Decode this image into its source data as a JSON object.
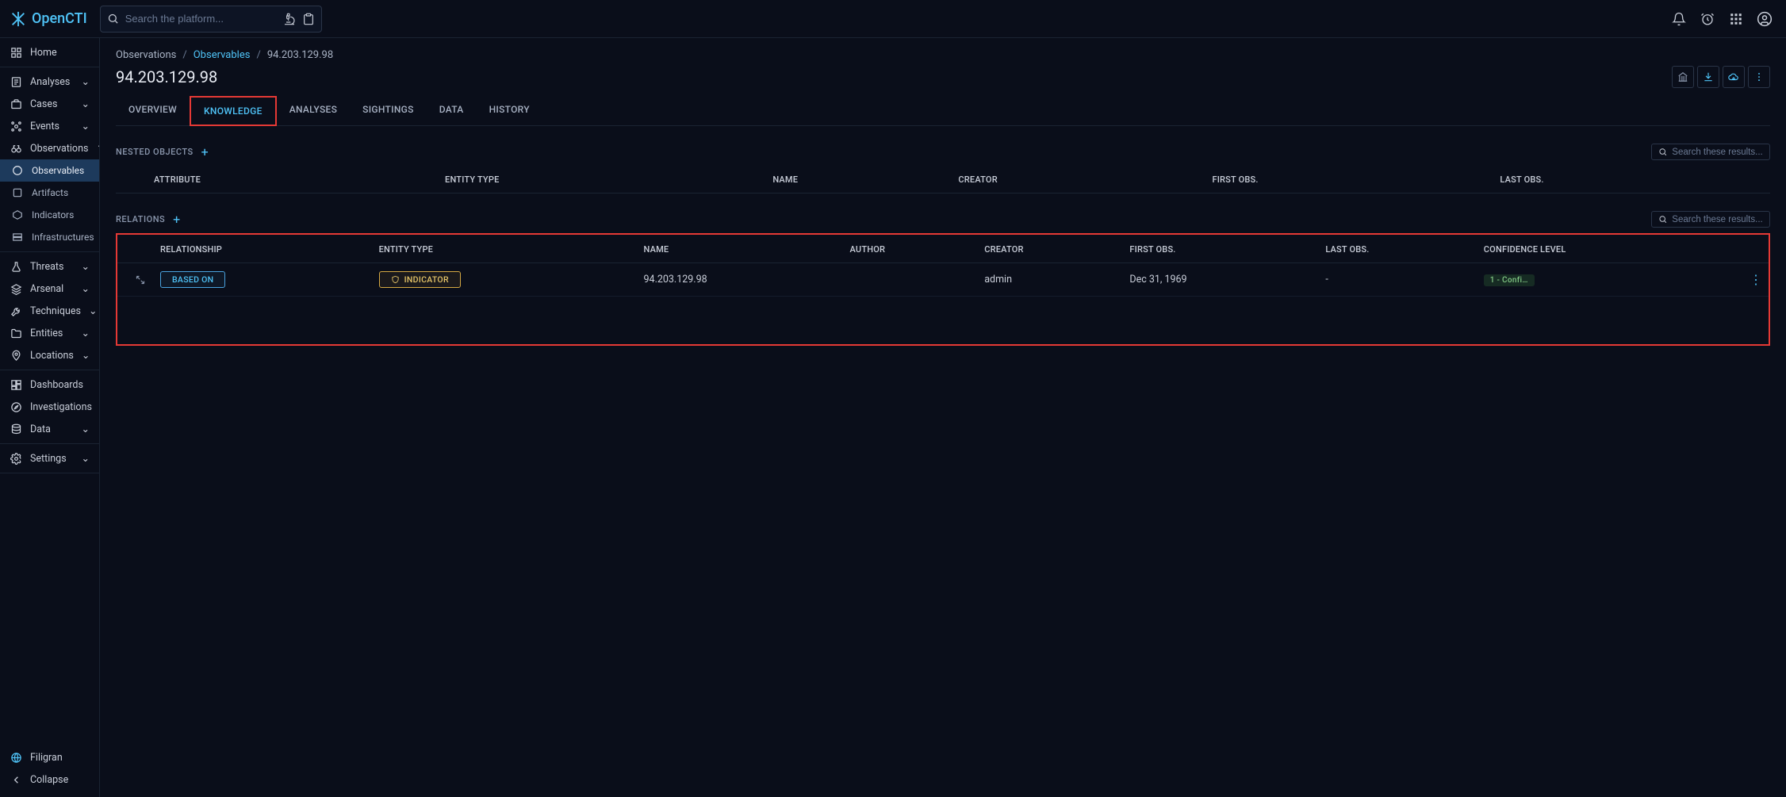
{
  "app": {
    "name": "OpenCTI"
  },
  "search": {
    "placeholder": "Search the platform..."
  },
  "sidebar": {
    "home": "Home",
    "analyses": "Analyses",
    "cases": "Cases",
    "events": "Events",
    "observations": "Observations",
    "obs_children": {
      "observables": "Observables",
      "artifacts": "Artifacts",
      "indicators": "Indicators",
      "infrastructures": "Infrastructures"
    },
    "threats": "Threats",
    "arsenal": "Arsenal",
    "techniques": "Techniques",
    "entities": "Entities",
    "locations": "Locations",
    "dashboards": "Dashboards",
    "investigations": "Investigations",
    "data": "Data",
    "settings": "Settings",
    "filigran": "Filigran",
    "collapse": "Collapse"
  },
  "breadcrumb": {
    "level1": "Observations",
    "level2": "Observables",
    "level3": "94.203.129.98"
  },
  "page": {
    "title": "94.203.129.98"
  },
  "tabs": {
    "overview": "OVERVIEW",
    "knowledge": "KNOWLEDGE",
    "analyses": "ANALYSES",
    "sightings": "SIGHTINGS",
    "data": "DATA",
    "history": "HISTORY"
  },
  "nested": {
    "title": "NESTED OBJECTS",
    "search_placeholder": "Search these results...",
    "headers": {
      "attribute": "ATTRIBUTE",
      "entity_type": "ENTITY TYPE",
      "name": "NAME",
      "creator": "CREATOR",
      "first_obs": "FIRST OBS.",
      "last_obs": "LAST OBS."
    }
  },
  "relations": {
    "title": "RELATIONS",
    "search_placeholder": "Search these results...",
    "headers": {
      "relationship": "RELATIONSHIP",
      "entity_type": "ENTITY TYPE",
      "name": "NAME",
      "author": "AUTHOR",
      "creator": "CREATOR",
      "first_obs": "FIRST OBS.",
      "last_obs": "LAST OBS.",
      "confidence": "CONFIDENCE LEVEL"
    },
    "rows": [
      {
        "relationship": "BASED ON",
        "entity_type": "INDICATOR",
        "name": "94.203.129.98",
        "author": "",
        "creator": "admin",
        "first_obs": "Dec 31, 1969",
        "last_obs": "-",
        "confidence": "1 - Confi…"
      }
    ]
  }
}
